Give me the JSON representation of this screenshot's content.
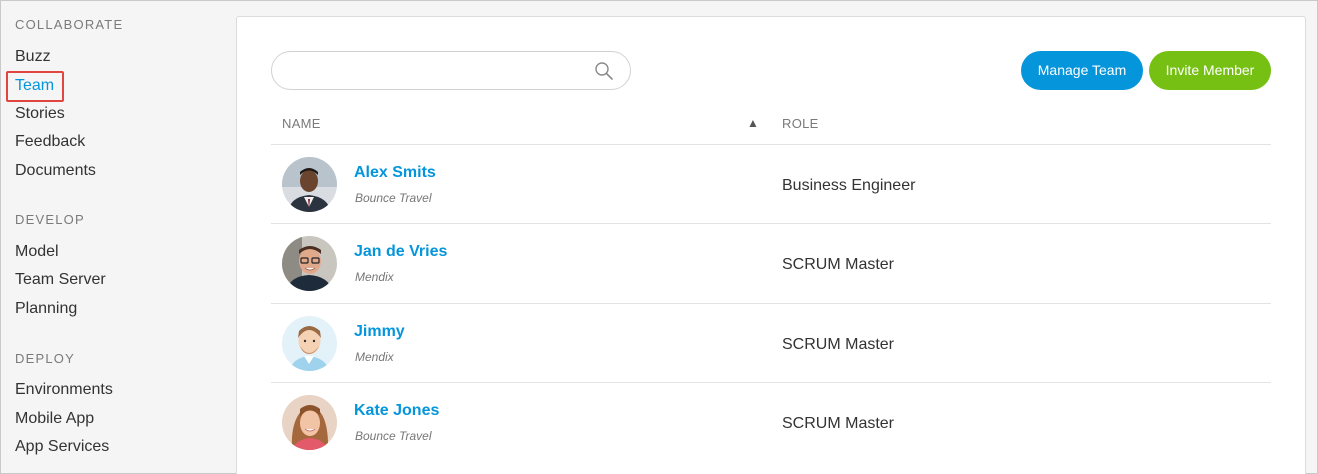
{
  "sidebar": {
    "sections": [
      {
        "title": "COLLABORATE",
        "items": [
          "Buzz",
          "Team",
          "Stories",
          "Feedback",
          "Documents"
        ]
      },
      {
        "title": "DEVELOP",
        "items": [
          "Model",
          "Team Server",
          "Planning"
        ]
      },
      {
        "title": "DEPLOY",
        "items": [
          "Environments",
          "Mobile App",
          "App Services"
        ]
      }
    ],
    "active_item": "Team"
  },
  "search": {
    "placeholder": "",
    "value": ""
  },
  "actions": {
    "manage_label": "Manage Team",
    "invite_label": "Invite Member"
  },
  "table": {
    "headers": {
      "name": "NAME",
      "role": "ROLE"
    },
    "sort_indicator": "▲",
    "rows": [
      {
        "name": "Alex Smits",
        "company": "Bounce Travel",
        "role": "Business Engineer",
        "avatar": "photo-avatar-man-suit"
      },
      {
        "name": "Jan de Vries",
        "company": "Mendix",
        "role": "SCRUM Master",
        "avatar": "photo-avatar-man-glasses"
      },
      {
        "name": "Jimmy",
        "company": "Mendix",
        "role": "SCRUM Master",
        "avatar": "illustrated-avatar-man"
      },
      {
        "name": "Kate Jones",
        "company": "Bounce Travel",
        "role": "SCRUM Master",
        "avatar": "photo-avatar-woman"
      }
    ]
  },
  "colors": {
    "accent_blue": "#0595db",
    "accent_green": "#76c014",
    "highlight_red": "#e0463f"
  }
}
